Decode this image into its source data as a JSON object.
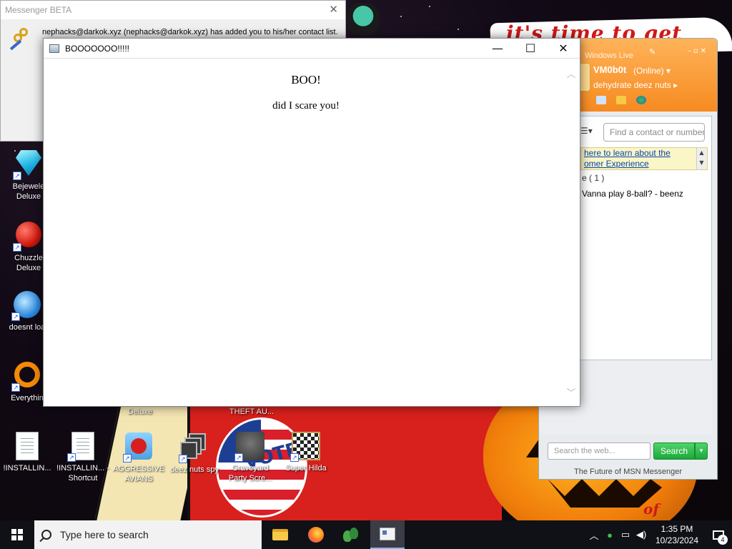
{
  "toast": {
    "title": "Messenger BETA",
    "message": "nephacks@darkok.xyz (nephacks@darkok.xyz) has added you to his/her contact list."
  },
  "boo_window": {
    "title": "BOOOOOOO!!!!!",
    "heading": "BOO!",
    "text": "did I scare you!"
  },
  "msn": {
    "brand": "Windows Live",
    "username": "VM0b0t",
    "status": "(Online)",
    "personal_message": "dehydrate deez nuts",
    "find_placeholder": "Find a contact or number",
    "banner_line1": "here to learn about the",
    "banner_line2": "omer Experience",
    "group": "e ( 1 )",
    "contact": "Vanna play 8-ball? - beenz",
    "search_placeholder": "Search the web...",
    "search_button": "Search",
    "footer": "The Future of MSN Messenger"
  },
  "desktop_icons": [
    {
      "label": "Bejewele Deluxe",
      "icon": "gem-icon"
    },
    {
      "label": "Chuzzle Deluxe",
      "icon": "chuzzle-icon"
    },
    {
      "label": "doesnt loa",
      "icon": "bird-icon"
    },
    {
      "label": "Everythin",
      "icon": "everything-icon"
    },
    {
      "label": "Deluxe",
      "icon": "hidden-icon"
    },
    {
      "label": "THEFT AU...",
      "icon": "hidden-icon"
    },
    {
      "label": "!INSTALLIN...",
      "icon": "document-icon"
    },
    {
      "label": "!INSTALLIN... - Shortcut",
      "icon": "document-shortcut-icon"
    },
    {
      "label": "AGGRESSIVE AVIANS",
      "icon": "angry-bird-icon"
    },
    {
      "label": "deez nuts spy",
      "icon": "windows-stack-icon"
    },
    {
      "label": "Graveyard Party Scre...",
      "icon": "soldier-icon"
    },
    {
      "label": "Super Hilda",
      "icon": "hilda-icon"
    }
  ],
  "wallpaper": {
    "sign_text": "it's time to get shit",
    "pumpkin_text": "of",
    "badge_text": "VOTE"
  },
  "taskbar": {
    "search_placeholder": "Type here to search",
    "time": "1:35 PM",
    "date": "10/23/2024",
    "notification_count": "4"
  },
  "colors": {
    "msn_orange": "#f68a20",
    "search_green": "#1ca83a",
    "taskbar": "#0f1116"
  }
}
